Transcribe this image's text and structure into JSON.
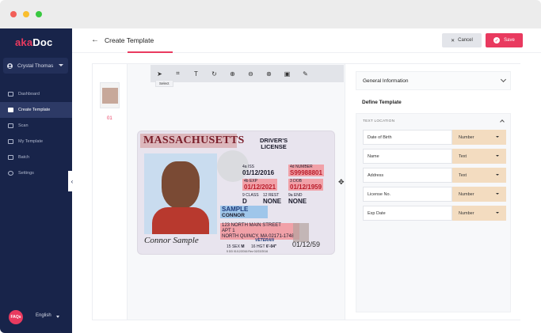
{
  "app": {
    "logo_prefix": "aka",
    "logo_suffix": "Doc"
  },
  "user": {
    "name": "Crystal Thomas"
  },
  "sidebar": {
    "items": [
      {
        "label": "Dashboard",
        "icon": "grid-icon",
        "active": false
      },
      {
        "label": "Create Template",
        "icon": "folder-plus-icon",
        "active": true
      },
      {
        "label": "Scan",
        "icon": "scan-icon",
        "active": false
      },
      {
        "label": "My Template",
        "icon": "folder-icon",
        "active": false
      },
      {
        "label": "Batch",
        "icon": "batch-icon",
        "active": false
      },
      {
        "label": "Settings",
        "icon": "gear-icon",
        "active": false
      }
    ],
    "faq_label": "FAQs",
    "language": "English"
  },
  "header": {
    "title": "Create Template",
    "cancel_label": "Cancel",
    "save_label": "Save"
  },
  "pages": {
    "thumb_number": "01"
  },
  "toolbar": {
    "tools": [
      "select-icon",
      "crop-icon",
      "text-icon",
      "rotate-icon",
      "zoom-in-icon",
      "zoom-out-icon",
      "clear-icon",
      "layers-icon",
      "pen-icon"
    ],
    "tooltip": "Select"
  },
  "card": {
    "state": "MASSACHUSETTS",
    "doc_line1": "DRIVER'S",
    "doc_line2": "LICENSE",
    "iss_label": "4a ISS",
    "iss_value": "01/12/2016",
    "number_label": "4d NUMBER",
    "number_value": "S99988801",
    "exp_label": "4b EXP",
    "exp_value": "01/12/2021",
    "dob_label": "3 DOB",
    "dob_value": "01/12/1959",
    "class_label": "9 CLASS",
    "class_value": "D",
    "rest_label": "12 REST",
    "rest_value": "NONE",
    "end_label": "9a END",
    "end_value": "NONE",
    "last_name": "SAMPLE",
    "first_name": "CONNOR",
    "address1": "123 NORTH MAIN STREET",
    "address2": "APT 1",
    "address3": "NORTH QUINCY, MA 02171-1748",
    "sex_label": "15 SEX",
    "sex_value": "M",
    "hgt_label": "16 HGT",
    "hgt_value": "6'-04\"",
    "veteran": "VETERAN",
    "bottom_date": "01/12/59",
    "signature": "Connor Sample",
    "dd_line": "5 DD 01/12/2016 Rev 02/22/2016"
  },
  "panel": {
    "general_info": "General Information",
    "define_template": "Define Template",
    "text_location": "TEXT LOCATION",
    "fields": [
      {
        "name": "Date of Birth",
        "type": "Number"
      },
      {
        "name": "Name",
        "type": "Text"
      },
      {
        "name": "Address",
        "type": "Text"
      },
      {
        "name": "License No.",
        "type": "Number"
      },
      {
        "name": "Exp Date",
        "type": "Number"
      }
    ]
  },
  "colors": {
    "sidebar": "#18244a",
    "accent": "#e93a5f",
    "type_chip": "#f3dcc0"
  }
}
